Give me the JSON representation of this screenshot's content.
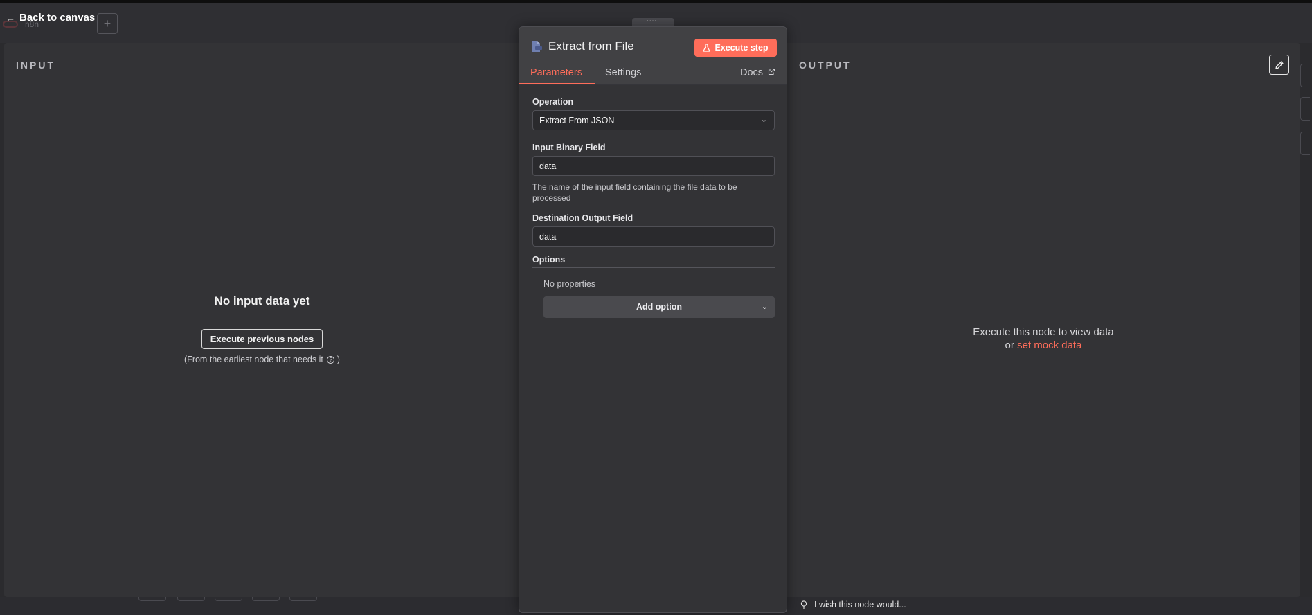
{
  "header": {
    "back_label": "Back to canvas",
    "logo_text": "n8n"
  },
  "input_panel": {
    "heading": "INPUT",
    "empty_title": "No input data yet",
    "execute_previous_label": "Execute previous nodes",
    "hint": "(From the earliest node that needs it",
    "hint_suffix": ")"
  },
  "output_panel": {
    "heading": "OUTPUT",
    "empty_line1": "Execute this node to view data",
    "empty_or": "or",
    "mock_link": "set mock data"
  },
  "node": {
    "title": "Extract from File",
    "execute_step_label": "Execute step",
    "tabs": [
      {
        "label": "Parameters",
        "active": true
      },
      {
        "label": "Settings",
        "active": false
      },
      {
        "label": "Docs",
        "active": false
      }
    ],
    "drag_handle": ":::::",
    "params": {
      "operation_label": "Operation",
      "operation_value": "Extract From JSON",
      "binary_field_label": "Input Binary Field",
      "binary_field_value": "data",
      "binary_field_hint": "The name of the input field containing the file data to be processed",
      "dest_field_label": "Destination Output Field",
      "dest_field_value": "data",
      "options_label": "Options",
      "no_properties": "No properties",
      "add_option_label": "Add option"
    }
  },
  "feedback": {
    "label": "I wish this node would..."
  },
  "colors": {
    "accent": "#ff6d5a",
    "panel": "#333336",
    "node_panel": "#414144"
  }
}
